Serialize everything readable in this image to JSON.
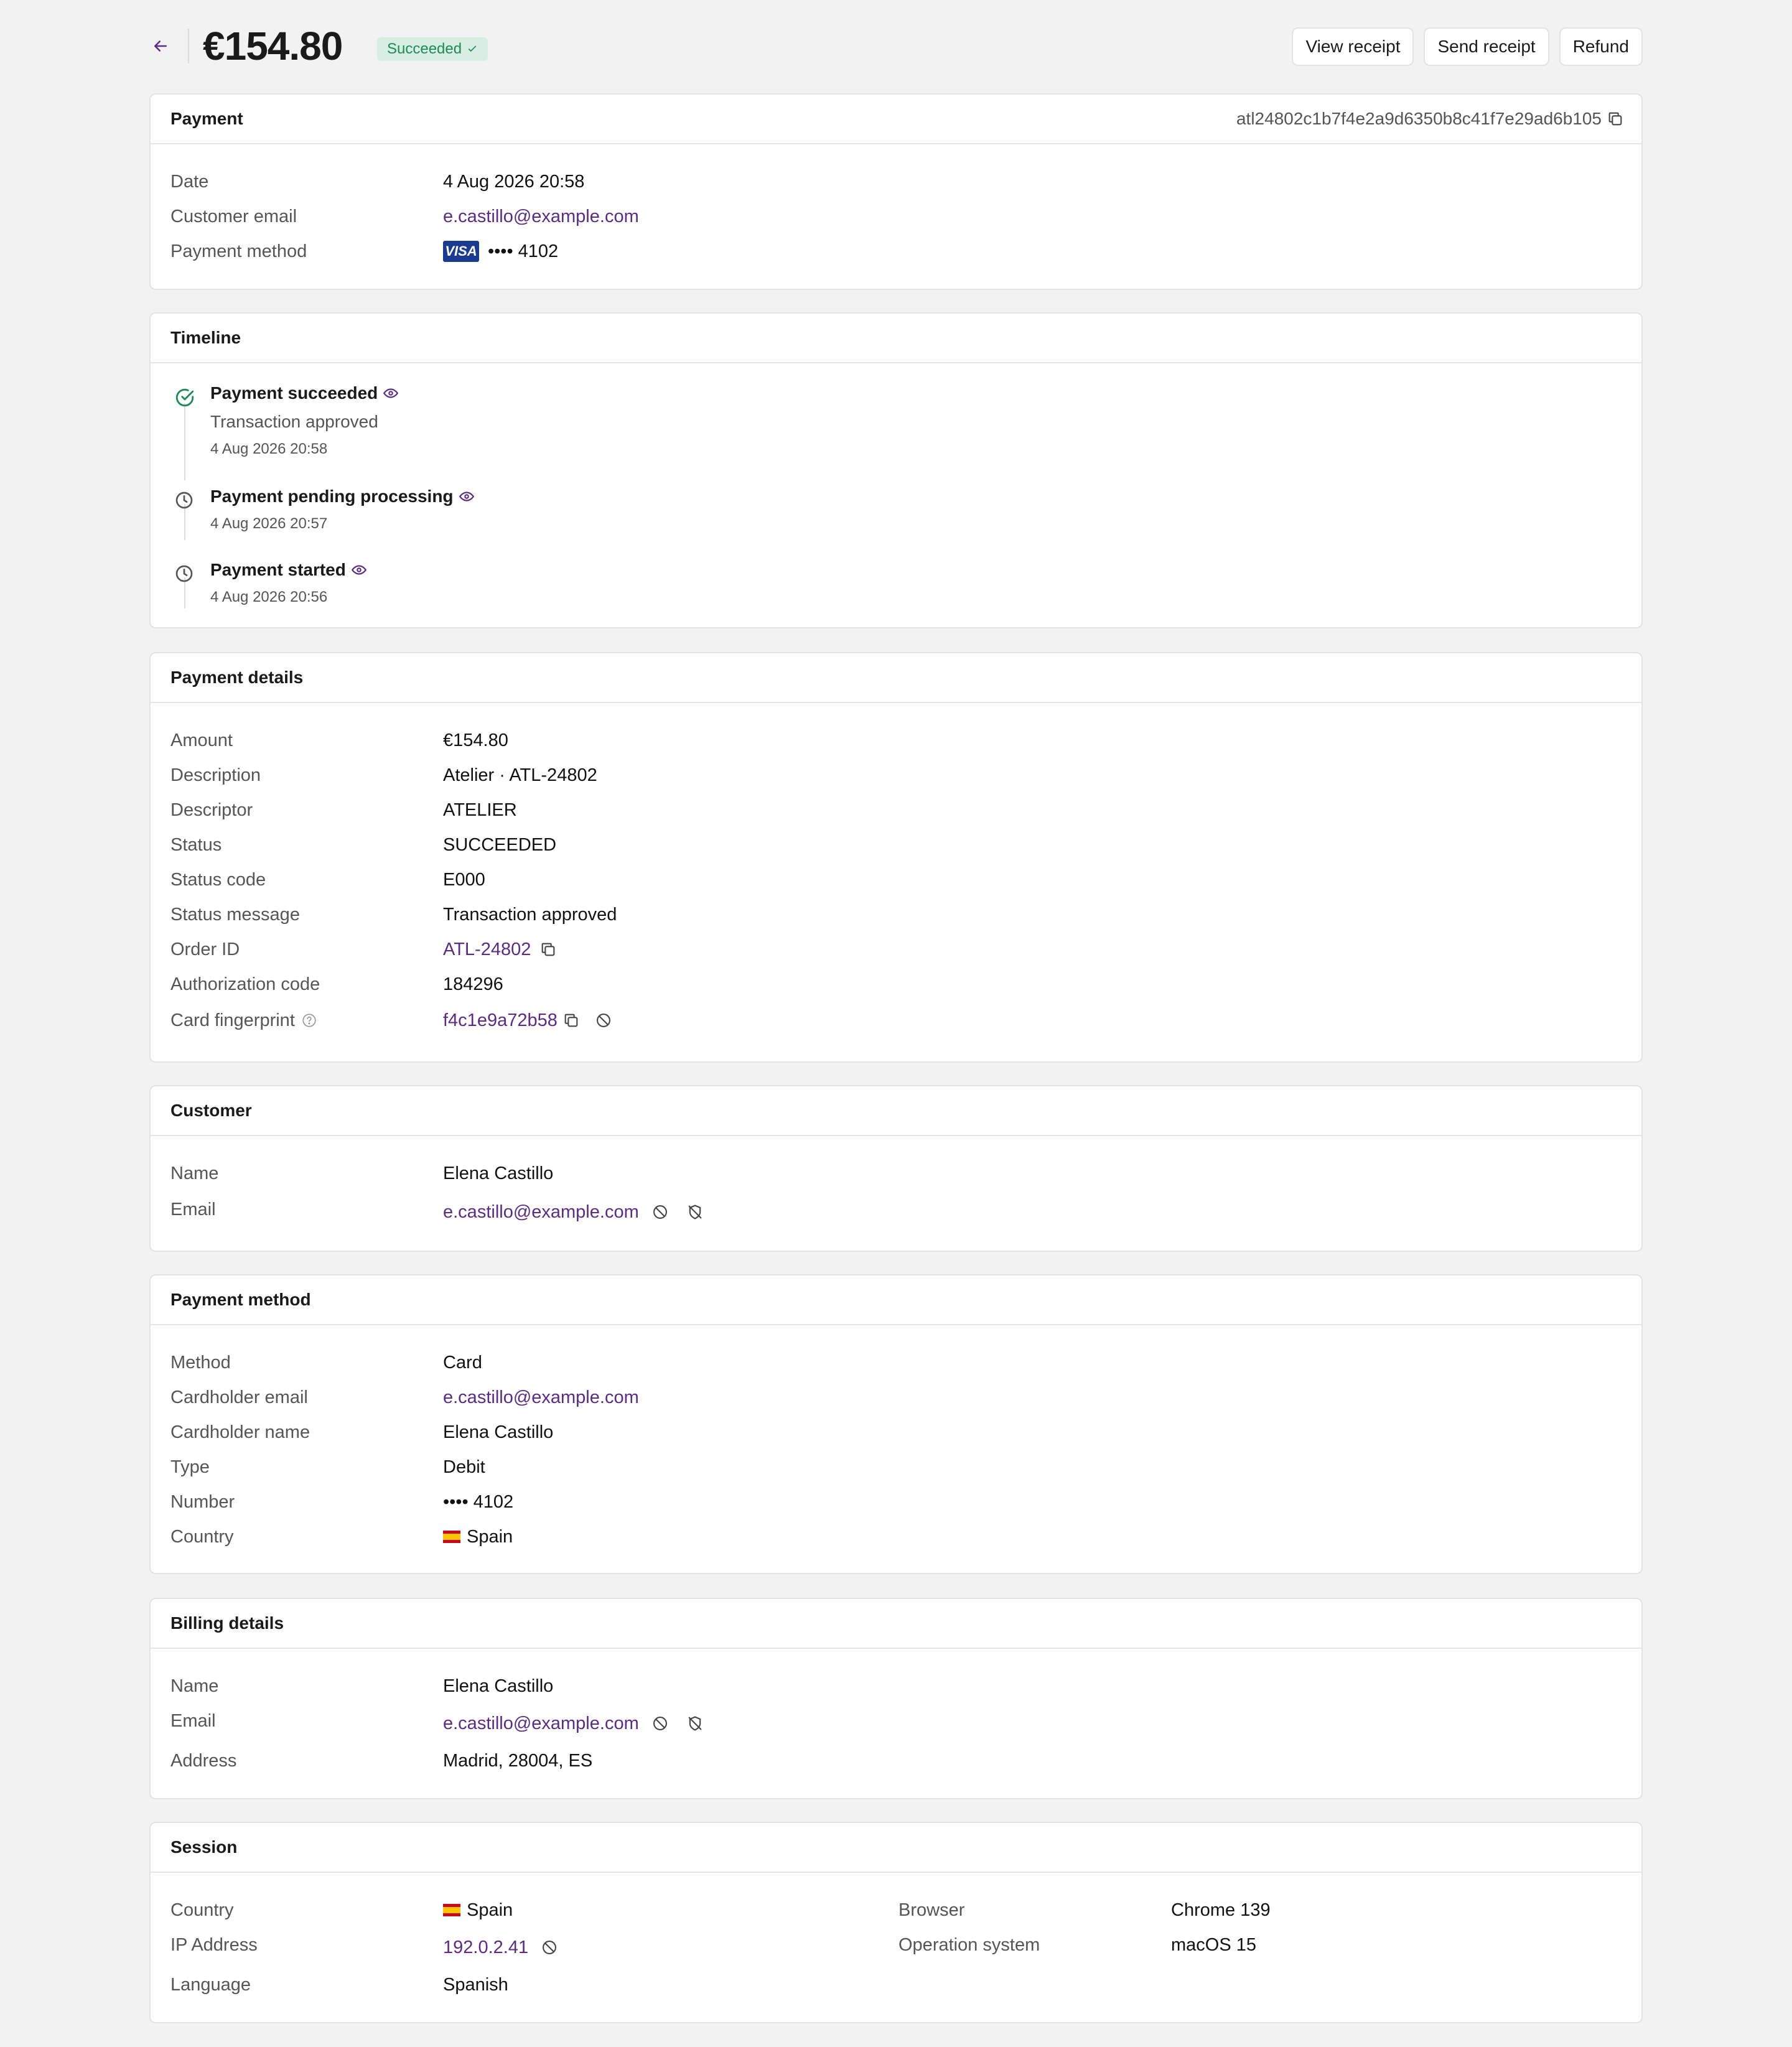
{
  "header": {
    "amount": "€154.80",
    "status_badge": "Succeeded",
    "actions": {
      "view_receipt": "View receipt",
      "send_receipt": "Send receipt",
      "refund": "Refund"
    }
  },
  "payment": {
    "title": "Payment",
    "id": "atl24802c1b7f4e2a9d6350b8c41f7e29ad6b105",
    "rows": {
      "date_label": "Date",
      "date_value": "4 Aug 2026 20:58",
      "email_label": "Customer email",
      "email_value": "e.castillo@example.com",
      "method_label": "Payment method",
      "card_brand": "VISA",
      "method_value": "•••• 4102"
    }
  },
  "timeline": {
    "title": "Timeline",
    "events": [
      {
        "title": "Payment succeeded",
        "subtitle": "Transaction approved",
        "date": "4 Aug 2026 20:58"
      },
      {
        "title": "Payment pending processing",
        "date": "4 Aug 2026 20:57"
      },
      {
        "title": "Payment started",
        "date": "4 Aug 2026 20:56"
      }
    ]
  },
  "payment_details": {
    "title": "Payment details",
    "amount_label": "Amount",
    "amount_value": "€154.80",
    "description_label": "Description",
    "description_value": "Atelier · ATL-24802",
    "descriptor_label": "Descriptor",
    "descriptor_value": "ATELIER",
    "status_label": "Status",
    "status_value": "SUCCEEDED",
    "status_code_label": "Status code",
    "status_code_value": "E000",
    "status_message_label": "Status message",
    "status_message_value": "Transaction approved",
    "order_id_label": "Order ID",
    "order_id_value": "ATL-24802",
    "auth_code_label": "Authorization code",
    "auth_code_value": "184296",
    "fingerprint_label": "Card fingerprint",
    "fingerprint_value": "f4c1e9a72b58"
  },
  "customer": {
    "title": "Customer",
    "name_label": "Name",
    "name_value": "Elena Castillo",
    "email_label": "Email",
    "email_value": "e.castillo@example.com"
  },
  "payment_method": {
    "title": "Payment method",
    "method_label": "Method",
    "method_value": "Card",
    "ch_email_label": "Cardholder email",
    "ch_email_value": "e.castillo@example.com",
    "ch_name_label": "Cardholder name",
    "ch_name_value": "Elena Castillo",
    "type_label": "Type",
    "type_value": "Debit",
    "number_label": "Number",
    "number_value": "•••• 4102",
    "country_label": "Country",
    "country_value": "Spain"
  },
  "billing": {
    "title": "Billing details",
    "name_label": "Name",
    "name_value": "Elena Castillo",
    "email_label": "Email",
    "email_value": "e.castillo@example.com",
    "address_label": "Address",
    "address_value": "Madrid, 28004, ES"
  },
  "session": {
    "title": "Session",
    "country_label": "Country",
    "country_value": "Spain",
    "ip_label": "IP Address",
    "ip_value": "192.0.2.41",
    "language_label": "Language",
    "language_value": "Spanish",
    "browser_label": "Browser",
    "browser_value": "Chrome 139",
    "os_label": "Operation system",
    "os_value": "macOS 15"
  },
  "colors": {
    "accent": "#5b2c82",
    "success": "#1f8a57",
    "success_bg": "#d7efe3",
    "background": "#f2f2f2"
  }
}
